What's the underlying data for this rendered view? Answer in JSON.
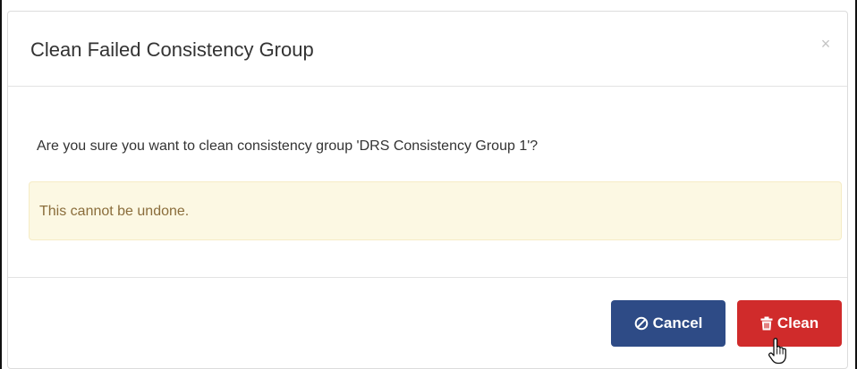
{
  "modal": {
    "title": "Clean Failed Consistency Group",
    "close_glyph": "×",
    "question": "Are you sure you want to clean consistency group 'DRS Consistency Group 1'?",
    "warning": "This cannot be undone.",
    "buttons": {
      "cancel_label": "Cancel",
      "cancel_icon": "ban-icon",
      "clean_label": "Clean",
      "clean_icon": "trash-icon"
    }
  },
  "colors": {
    "cancel": "#2e4b86",
    "clean": "#d02b2b",
    "warning_bg": "#fcf8e3",
    "warning_text": "#8a6d3b"
  }
}
